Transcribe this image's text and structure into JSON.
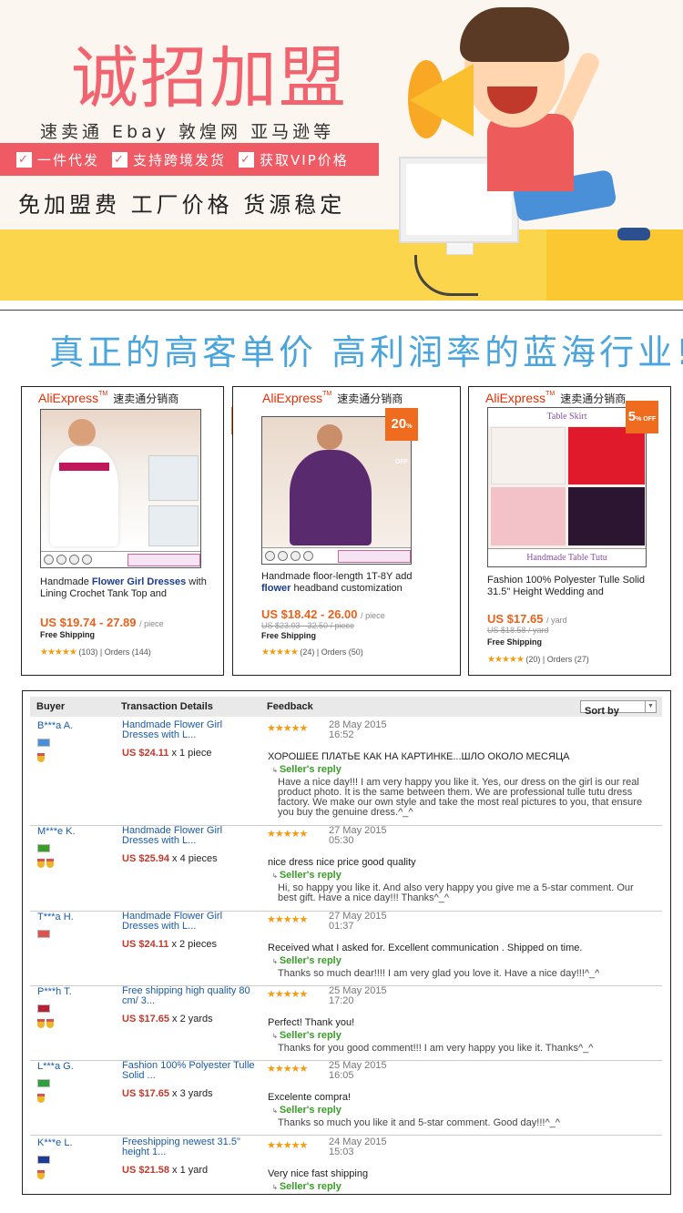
{
  "hero": {
    "title": "诚招加盟",
    "platforms": "速卖通 Ebay 敦煌网 亚马逊等",
    "features": [
      "一件代发",
      "支持跨境发货",
      "获取VIP价格"
    ],
    "slogan": "免加盟费 工厂价格 货源稳定",
    "check_mark": "✓"
  },
  "tagline": "真正的高客单价 高利润率的蓝海行业!",
  "cards": [
    {
      "brand": "AliExpress",
      "brand_cn": "速卖通分销商",
      "title_pre": "Handmade ",
      "title_bold": "Flower Girl Dresses",
      "title_post": " with Lining Crochet Tank Top and",
      "price": "US $19.74 - 27.89",
      "unit": "/ piece",
      "old_price": "",
      "shipping": "Free Shipping",
      "rating": "(103)  |  Orders (144)",
      "badge": ""
    },
    {
      "brand": "AliExpress",
      "brand_cn": "速卖通分销商",
      "title_pre": "Handmade floor-length 1T-8Y add ",
      "title_bold": "flower",
      "title_post": " headband customization",
      "price": "US $18.42 - 26.00",
      "unit": "/ piece",
      "old_price": "US $23.03 - 32.50 / piece",
      "shipping": "Free Shipping",
      "rating": "(24)  |  Orders (50)",
      "badge": "20",
      "badge_off": "% OFF"
    },
    {
      "brand": "AliExpress",
      "brand_cn": "速卖通分销商",
      "title_pre": "Fashion 100% Polyester Tulle Solid 31.5\" Height Wedding and",
      "title_bold": "",
      "title_post": "",
      "price": "US $17.65",
      "unit": "/ yard",
      "old_price": "US $18.58 / yard",
      "shipping": "Free Shipping",
      "rating": "(20)  |  Orders (27)",
      "badge": "5",
      "badge_off": "% OFF",
      "img_label": "Table Skirt",
      "img_footer": "Handmade Table Tutu"
    }
  ],
  "stars": "★★★★★",
  "feedback": {
    "headers": {
      "buyer": "Buyer",
      "transaction": "Transaction Details",
      "feedback": "Feedback"
    },
    "sort_label": "Sort by",
    "seller_reply_label": "Seller's reply",
    "rows": [
      {
        "buyer": "B***a A.",
        "item": "Handmade Flower Girl Dresses with L...",
        "price": "US $24.11",
        "qty": "x 1 piece",
        "date": "28 May 2015",
        "time": "16:52",
        "comment": "ХОРОШЕЕ ПЛАТЬЕ КАК НА КАРТИНКЕ...ШЛО ОКОЛО МЕСЯЦА",
        "reply": "Have a nice day!!! I am very happy you like it. Yes, our dress on the girl is our real product photo. It is the same between them. We are professional tulle tutu dress factory. We make our own style and take the most real pictures to you, that ensure you buy the genuine dress.^_^",
        "medals": 1,
        "flag_color": "#4a8fd9"
      },
      {
        "buyer": "M***e K.",
        "item": "Handmade Flower Girl Dresses with L...",
        "price": "US $25.94",
        "qty": "x 4 pieces",
        "date": "27 May 2015",
        "time": "05:30",
        "comment": "nice dress nice price good quality",
        "reply": "Hi, so happy you like it. And also very happy you give me a 5-star comment. Our best gift. Have a nice day!!! Thanks^_^",
        "medals": 2,
        "flag_color": "#3a9c2a"
      },
      {
        "buyer": "T***a H.",
        "item": "Handmade Flower Girl Dresses with L...",
        "price": "US $24.11",
        "qty": "x 2 pieces",
        "date": "27 May 2015",
        "time": "01:37",
        "comment": "Received what I asked for. Excellent communication . Shipped on time.",
        "reply": "Thanks so much dear!!!! I am very glad you love it. Have a nice day!!!^_^",
        "medals": 0,
        "flag_color": "#d9534f"
      },
      {
        "buyer": "P***h T.",
        "item": "Free shipping high quality 80 cm/ 3...",
        "price": "US $17.65",
        "qty": "x 2 yards",
        "date": "25 May 2015",
        "time": "17:20",
        "comment": "Perfect! Thank you!",
        "reply": "Thanks for you good comment!!! I am very happy you like it. Thanks^_^",
        "medals": 2,
        "flag_color": "#b22234"
      },
      {
        "buyer": "L***a G.",
        "item": "Fashion 100% Polyester Tulle Solid ...",
        "price": "US $17.65",
        "qty": "x 3 yards",
        "date": "25 May 2015",
        "time": "16:05",
        "comment": "Excelente compra!",
        "reply": "Thanks so much you like it and 5-star comment. Good day!!!^_^",
        "medals": 1,
        "flag_color": "#2e9e3e"
      },
      {
        "buyer": "K***e L.",
        "item": "Freeshipping newest 31.5\" height 1...",
        "price": "US $21.58",
        "qty": "x 1 yard",
        "date": "24 May 2015",
        "time": "15:03",
        "comment": "Very nice fast shipping",
        "reply": "",
        "medals": 1,
        "flag_color": "#1f3a93"
      }
    ]
  },
  "colors": {
    "accent_red": "#ef5a64",
    "tagline_blue": "#4aa5dc",
    "price_orange": "#e8621b",
    "link_blue": "#1a5ba6",
    "reply_green": "#3a9c2a"
  }
}
